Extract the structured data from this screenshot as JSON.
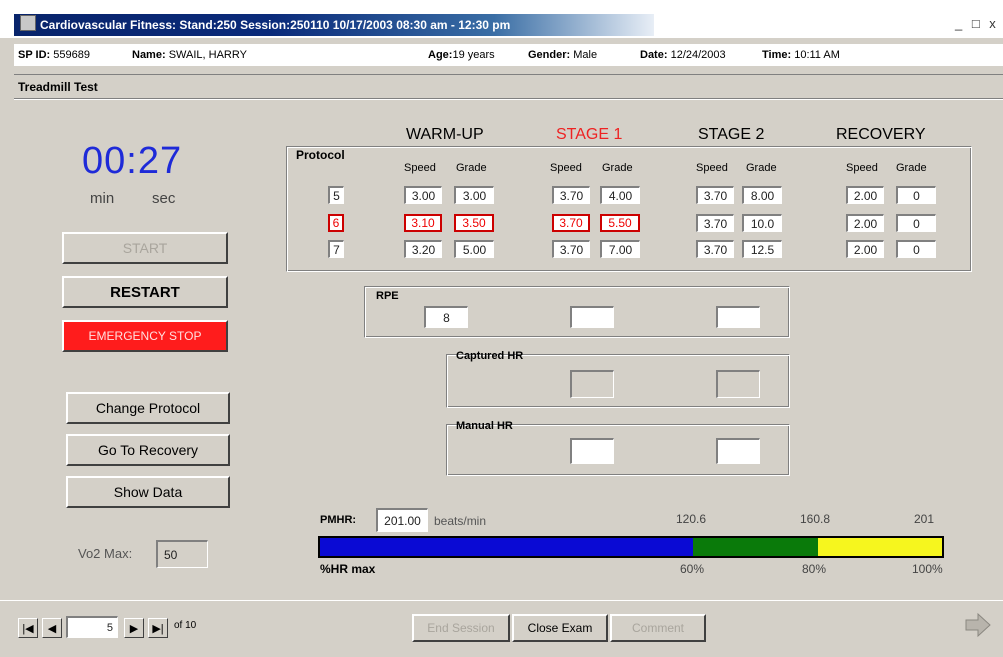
{
  "window": {
    "title": "Cardiovascular Fitness: Stand:250 Session:250110 10/17/2003 08:30 am - 12:30 pm",
    "controls": "_ □ x"
  },
  "info": {
    "sp_id_label": "SP ID:",
    "sp_id": "559689",
    "name_label": "Name:",
    "name": "SWAIL, HARRY",
    "age_label": "Age:",
    "age": "19 years",
    "gender_label": "Gender:",
    "gender": "Male",
    "date_label": "Date:",
    "date": "12/24/2003",
    "time_label": "Time:",
    "time": "10:11 AM"
  },
  "section": {
    "title": "Treadmill Test"
  },
  "timer": {
    "value": "00:27",
    "min_label": "min",
    "sec_label": "sec"
  },
  "buttons": {
    "start": "START",
    "restart": "RESTART",
    "emergency": "EMERGENCY STOP",
    "change_protocol": "Change Protocol",
    "go_recovery": "Go To Recovery",
    "show_data": "Show Data"
  },
  "vo2": {
    "label": "Vo2 Max:",
    "value": "50"
  },
  "table": {
    "protocol_header": "Protocol",
    "stages": [
      "WARM-UP",
      "STAGE 1",
      "STAGE 2",
      "RECOVERY"
    ],
    "speed_label": "Speed",
    "grade_label": "Grade",
    "rows": [
      {
        "protocol": "5",
        "warmup": [
          "3.00",
          "3.00"
        ],
        "stage1": [
          "3.70",
          "4.00"
        ],
        "stage2": [
          "3.70",
          "8.00"
        ],
        "recovery": [
          "2.00",
          "0"
        ]
      },
      {
        "protocol": "6",
        "warmup": [
          "3.10",
          "3.50"
        ],
        "stage1": [
          "3.70",
          "5.50"
        ],
        "stage2": [
          "3.70",
          "10.0"
        ],
        "recovery": [
          "2.00",
          "0"
        ]
      },
      {
        "protocol": "7",
        "warmup": [
          "3.20",
          "5.00"
        ],
        "stage1": [
          "3.70",
          "7.00"
        ],
        "stage2": [
          "3.70",
          "12.5"
        ],
        "recovery": [
          "2.00",
          "0"
        ]
      }
    ]
  },
  "rpe": {
    "label": "RPE",
    "values": [
      "8",
      "",
      ""
    ]
  },
  "captured_hr": {
    "label": "Captured HR",
    "values": [
      "",
      ""
    ]
  },
  "manual_hr": {
    "label": "Manual HR",
    "values": [
      "",
      ""
    ]
  },
  "pmhr": {
    "label": "PMHR:",
    "value": "201.00",
    "unit": "beats/min",
    "marks": [
      "120.6",
      "160.8",
      "201"
    ],
    "pct_labels": [
      "60%",
      "80%",
      "100%"
    ],
    "bar_label": "%HR max",
    "colors": {
      "blue": "#0a0ad4",
      "green": "#0a7a0a",
      "yellow": "#f6f61e"
    },
    "segments_pct": [
      60,
      20,
      20
    ]
  },
  "nav": {
    "record": "5",
    "of_label": "of 10",
    "first_icon": "first-record-icon",
    "prev_icon": "prev-record-icon",
    "next_icon": "next-record-icon",
    "last_icon": "last-record-icon",
    "end_session": "End Session",
    "close_exam": "Close Exam",
    "comment": "Comment",
    "exit_icon": "exit-arrow-icon"
  },
  "accent": {
    "stage1": "#ee2222",
    "timer": "#1e2ad8"
  }
}
